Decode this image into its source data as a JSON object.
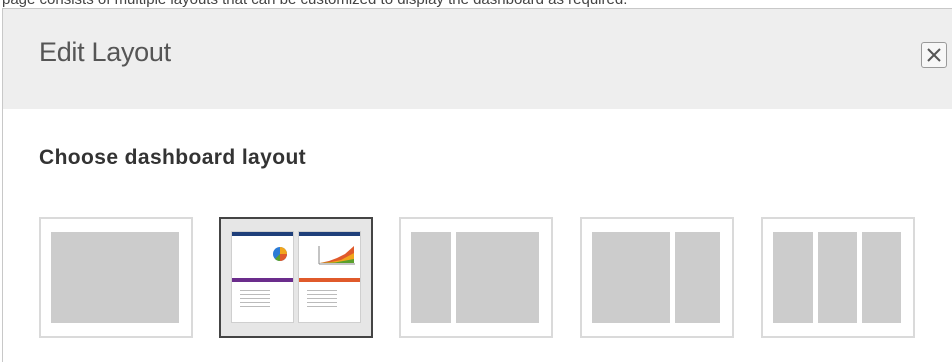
{
  "clipped_text": "page consists of multiple layouts that can be customized to display the dashboard as required.",
  "dialog": {
    "title": "Edit Layout",
    "close_icon": "close-x-icon"
  },
  "content": {
    "heading": "Choose dashboard layout"
  },
  "layouts": [
    {
      "name": "single-column",
      "selected": false
    },
    {
      "name": "two-equal-columns-preview",
      "selected": true
    },
    {
      "name": "two-columns-narrow-wide",
      "selected": false
    },
    {
      "name": "two-columns-wide-narrow",
      "selected": false
    },
    {
      "name": "three-equal-columns",
      "selected": false
    }
  ],
  "colors": {
    "header_bg": "#eeeeee",
    "panel_gray": "#cccccc",
    "selected_border": "#444444",
    "preview_bar_navy": "#1f3f7a",
    "preview_bar_purple": "#6b2d8c",
    "preview_bar_red": "#e05a2b"
  }
}
